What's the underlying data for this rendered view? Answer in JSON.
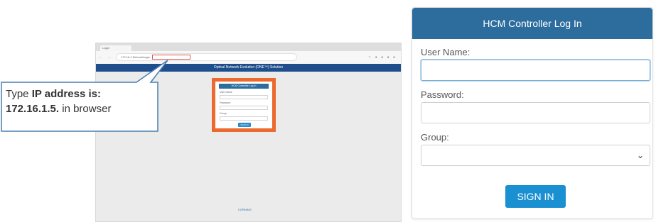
{
  "callout": {
    "prefix": "Type ",
    "bold1": "IP address is:",
    "bold2": "172.16.1.5.",
    "suffix": " in browser"
  },
  "mini_browser": {
    "tab_title": "Login",
    "url_text": "172.16.1.5/#/auth/login",
    "banner": "Optical Network Evolution (ONE™) Solution",
    "login_title": "HCM Controller Log In",
    "user_label": "User Name",
    "password_label": "Password",
    "group_label": "Group",
    "button": "SIGN IN",
    "footer_brand": "CORNING"
  },
  "login_panel": {
    "title": "HCM Controller Log In",
    "username_label": "User Name:",
    "password_label": "Password:",
    "group_label": "Group:",
    "signin_label": "SIGN IN"
  },
  "colors": {
    "header_blue": "#2d6d9e",
    "button_blue": "#1a8fd1",
    "highlight_orange": "#ec6a2e",
    "callout_border": "#4a7fb0"
  }
}
